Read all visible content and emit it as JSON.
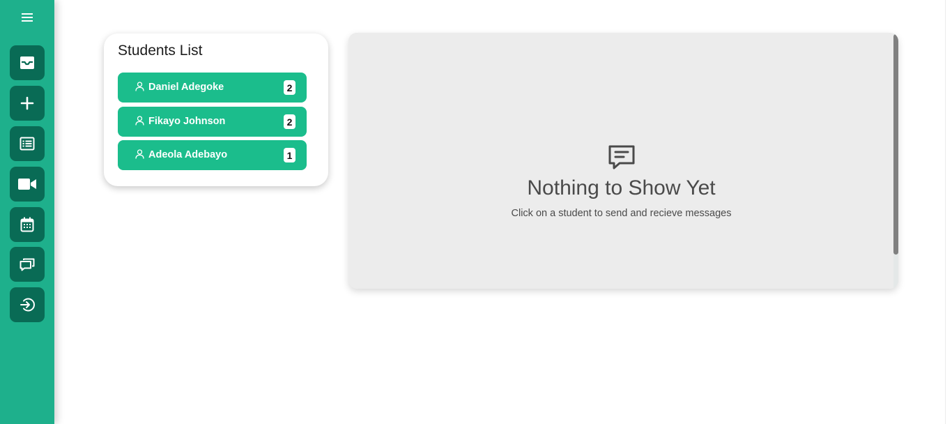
{
  "sidebar": {
    "menu_icon": "hamburger-menu-icon",
    "items": [
      {
        "name": "inbox",
        "icon": "inbox-icon"
      },
      {
        "name": "add",
        "icon": "plus-icon"
      },
      {
        "name": "list",
        "icon": "list-icon"
      },
      {
        "name": "video",
        "icon": "video-camera-icon"
      },
      {
        "name": "calendar",
        "icon": "calendar-icon"
      },
      {
        "name": "chat",
        "icon": "chat-bubbles-icon"
      },
      {
        "name": "logout",
        "icon": "logout-icon"
      }
    ],
    "color": "#1eb08c",
    "button_color": "#096b55"
  },
  "students": {
    "title": "Students List",
    "items": [
      {
        "name": "Daniel Adegoke",
        "count": "2"
      },
      {
        "name": "Fikayo Johnson",
        "count": "2"
      },
      {
        "name": "Adeola Adebayo",
        "count": "1"
      }
    ],
    "item_color": "#1bbd8c"
  },
  "messages": {
    "empty_title": "Nothing to Show Yet",
    "empty_subtitle": "Click on a student to send and recieve messages",
    "icon": "message-square-icon"
  }
}
